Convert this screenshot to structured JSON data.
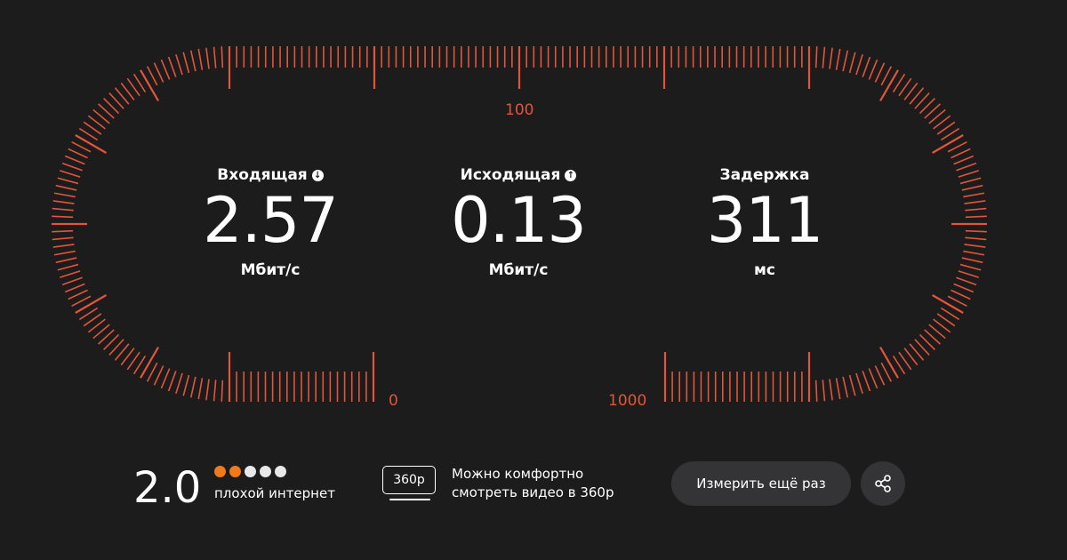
{
  "scale": {
    "label_top": "100",
    "label_zero": "0",
    "label_max": "1000",
    "accent": "#e2553b"
  },
  "metrics": {
    "download": {
      "title": "Входящая",
      "value": "2.57",
      "unit": "Мбит/с",
      "icon": "arrow-down-circle-icon"
    },
    "upload": {
      "title": "Исходящая",
      "value": "0.13",
      "unit": "Мбит/с",
      "icon": "arrow-up-circle-icon"
    },
    "latency": {
      "title": "Задержка",
      "value": "311",
      "unit": "мс"
    }
  },
  "rating": {
    "score": "2.0",
    "filled": 2,
    "total": 5,
    "label": "плохой интернет",
    "filled_color": "#f07a1a",
    "empty_color": "#e8e8e8"
  },
  "video": {
    "badge": "360p",
    "line1": "Можно комфортно",
    "line2": "смотреть видео в 360p"
  },
  "actions": {
    "retest_label": "Измерить ещё раз",
    "share_icon": "share-icon"
  }
}
